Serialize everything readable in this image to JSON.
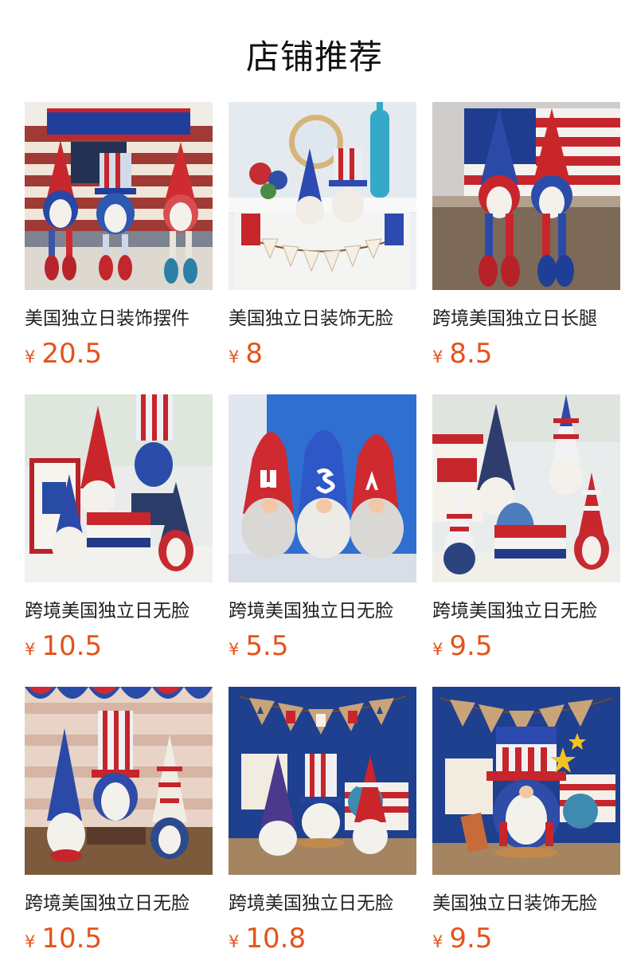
{
  "page": {
    "title": "店铺推荐"
  },
  "currency_symbol": "¥",
  "products": [
    {
      "name": "美国独立日装饰摆件",
      "price": "20.5",
      "image": "gnome-trio-on-shelf"
    },
    {
      "name": "美国独立日装饰无脸",
      "price": "8",
      "image": "gnomes-with-usa-banner"
    },
    {
      "name": "跨境美国独立日长腿",
      "price": "8.5",
      "image": "long-leg-gnomes-holiday-sign"
    },
    {
      "name": "跨境美国独立日无脸",
      "price": "10.5",
      "image": "gnomes-with-bless-america-sign"
    },
    {
      "name": "跨境美国独立日无脸",
      "price": "5.5",
      "image": "usa-hat-gnomes"
    },
    {
      "name": "跨境美国独立日无脸",
      "price": "9.5",
      "image": "gnome-group-with-statue"
    },
    {
      "name": "跨境美国独立日无脸",
      "price": "10.5",
      "image": "gnome-trio-with-bunting"
    },
    {
      "name": "跨境美国独立日无脸",
      "price": "10.8",
      "image": "gnomes-under-usa-garland"
    },
    {
      "name": "美国独立日装饰无脸",
      "price": "9.5",
      "image": "top-hat-gnome-with-stars"
    }
  ]
}
